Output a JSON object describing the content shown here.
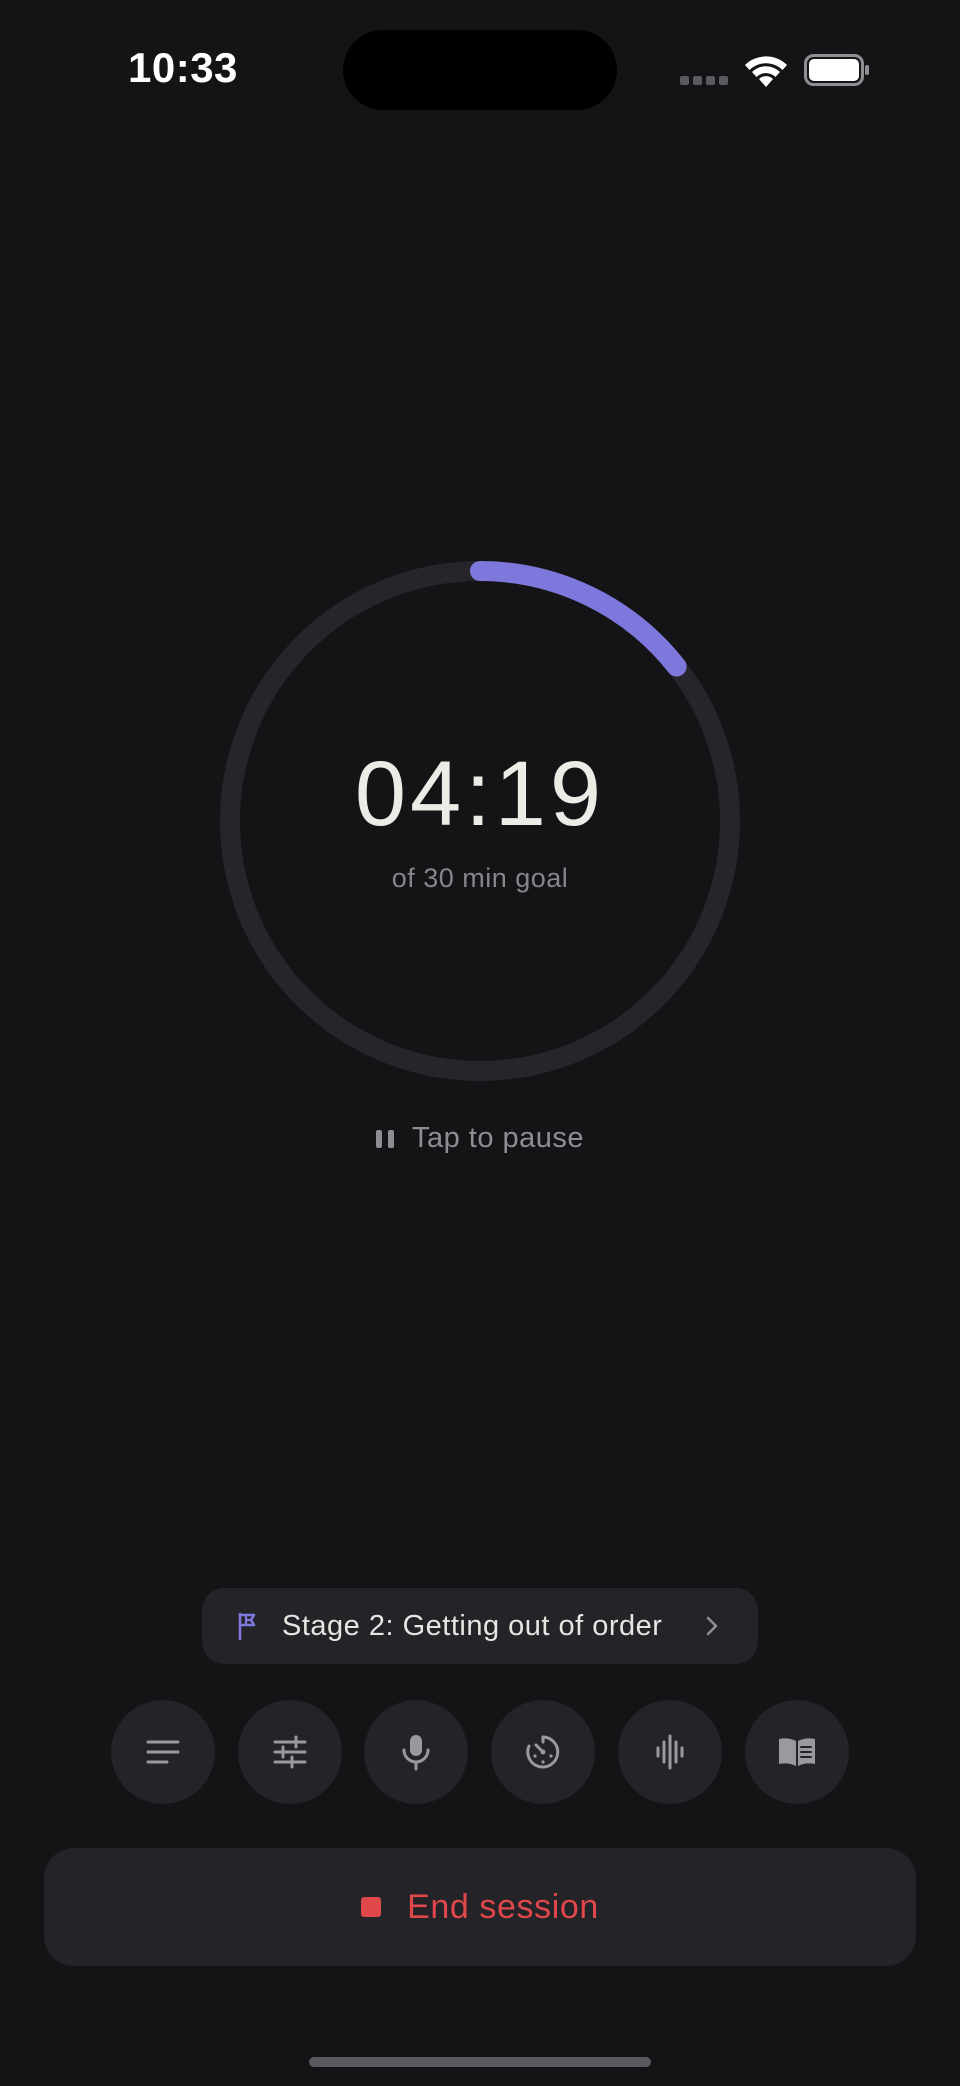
{
  "status_bar": {
    "time": "10:33",
    "icons": [
      "cellular-signal-icon",
      "wifi-icon",
      "battery-icon"
    ]
  },
  "timer": {
    "elapsed": "04:19",
    "goal_caption": "of 30 min goal",
    "progress_fraction": 0.144
  },
  "pause_hint": {
    "icon": "pause-icon",
    "label": "Tap to pause"
  },
  "stage": {
    "icon": "flag-icon",
    "label": "Stage 2: Getting out of order",
    "chevron": "chevron-right-icon"
  },
  "tools": [
    {
      "icon": "lines-icon"
    },
    {
      "icon": "sliders-icon"
    },
    {
      "icon": "microphone-icon"
    },
    {
      "icon": "timer-dial-icon"
    },
    {
      "icon": "waveform-icon"
    },
    {
      "icon": "open-book-icon"
    }
  ],
  "end_session": {
    "icon": "stop-square-icon",
    "label": "End session"
  },
  "colors": {
    "background": "#141416",
    "surface": "#232328",
    "accent": "#7f78dc",
    "danger": "#e0474b",
    "ring_track": "#26252b"
  }
}
